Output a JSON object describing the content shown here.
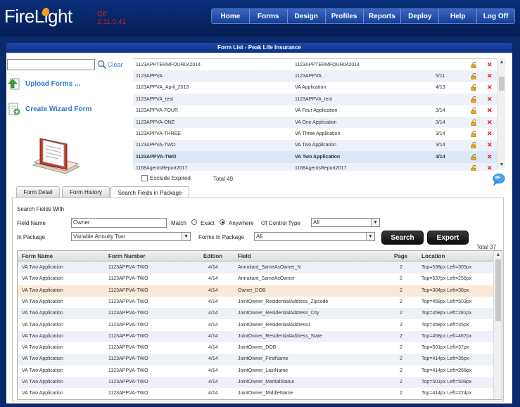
{
  "app": {
    "logo": "FireLight",
    "env_line1": "QE",
    "env_line2": "2.11.0.41"
  },
  "nav": [
    "Home",
    "Forms",
    "Design",
    "Profiles",
    "Reports",
    "Deploy",
    "Help",
    "Log Off"
  ],
  "title": "Form List - Peak Life Insurance",
  "sidebar": {
    "search_value": "",
    "clear": "Clear",
    "upload": "Upload Forms ...",
    "create": "Create Wizard Form"
  },
  "form_list": [
    {
      "num": "1123APPTERMFOUR042014",
      "name": "1123APPTERMFOUR042014",
      "ed": ""
    },
    {
      "num": "1123APPVA",
      "name": "1123APPVA",
      "ed": "5/11"
    },
    {
      "num": "1123APPVA_April_2013",
      "name": "VA Application",
      "ed": "4/13"
    },
    {
      "num": "1123APPVA_test",
      "name": "1123APPVA_test",
      "ed": ""
    },
    {
      "num": "1123APPVA-FOUR",
      "name": "VA Four Application",
      "ed": "3/14"
    },
    {
      "num": "1123APPVA-ONE",
      "name": "VA One Application",
      "ed": "3/14"
    },
    {
      "num": "1123APPVA-THREE",
      "name": "VA Three Application",
      "ed": "3/14"
    },
    {
      "num": "1123APPVA-TWO",
      "name": "VA Two Application",
      "ed": "3/14"
    },
    {
      "num": "1123APPVA-TWO",
      "name": "VA Two Application",
      "ed": "4/14"
    },
    {
      "num": "1168AgentsReport2017",
      "name": "1168AgentsReport2017",
      "ed": ""
    }
  ],
  "exclude_expired": "Exclude Expired",
  "total_forms": "Total 49.",
  "tabs": [
    "Form Detail",
    "Form History",
    "Search Fields in Package"
  ],
  "search": {
    "heading": "Search Fields With",
    "field_name_label": "Field Name",
    "field_name_value": "Owner",
    "match_label": "Match",
    "exact_label": "Exact",
    "anywhere_label": "Anywhere",
    "control_type_label": "Of Control Type",
    "control_type_value": "All",
    "in_package_label": "In Package",
    "in_package_value": "Variable Annuity Two",
    "forms_in_package_label": "Forms In Package",
    "forms_in_package_value": "All",
    "search_btn": "Search",
    "export_btn": "Export"
  },
  "total_results": "Total 37",
  "results_headers": [
    "Form Name",
    "Form Number",
    "Edition",
    "Field",
    "Page",
    "Location"
  ],
  "results": [
    [
      "VA Two Application",
      "1123APPVA-TWO",
      "4/14",
      "Annuitant_SameAsOwner_N",
      "2",
      "Top=538px Left=305px"
    ],
    [
      "VA Two Application",
      "1123APPVA-TWO",
      "4/14",
      "Annuitant_SameAsOwner",
      "2",
      "Top=537px Left=256px"
    ],
    [
      "VA Two Application",
      "1123APPVA-TWO",
      "4/14",
      "Owner_DOB",
      "2",
      "Top=304px Left=38px"
    ],
    [
      "VA Two Application",
      "1123APPVA-TWO",
      "4/14",
      "JointOwner_ResidentialAddress_Zipcode",
      "2",
      "Top=458px Left=503px"
    ],
    [
      "VA Two Application",
      "1123APPVA-TWO",
      "4/14",
      "JointOwner_ResidentialAddress_City",
      "2",
      "Top=458px Left=281px"
    ],
    [
      "VA Two Application",
      "1123APPVA-TWO",
      "4/14",
      "JointOwner_ResidentialAddress1",
      "2",
      "Top=458px Left=35px"
    ],
    [
      "VA Two Application",
      "1123APPVA-TWO",
      "4/14",
      "JointOwner_ResidentialAddress_State",
      "2",
      "Top=458px Left=467px"
    ],
    [
      "VA Two Application",
      "1123APPVA-TWO",
      "4/14",
      "JointOwner_DOB",
      "2",
      "Top=501px Left=37px"
    ],
    [
      "VA Two Application",
      "1123APPVA-TWO",
      "4/14",
      "JointOwner_FirstName",
      "2",
      "Top=414px Left=35px"
    ],
    [
      "VA Two Application",
      "1123APPVA-TWO",
      "4/14",
      "JointOwner_LastName",
      "2",
      "Top=414px Left=266px"
    ],
    [
      "VA Two Application",
      "1123APPVA-TWO",
      "4/14",
      "JointOwner_MaritalStatus",
      "2",
      "Top=501px Left=509px"
    ],
    [
      "VA Two Application",
      "1123APPVA-TWO",
      "4/14",
      "JointOwner_MiddleName",
      "2",
      "Top=414px Left=224px"
    ]
  ]
}
